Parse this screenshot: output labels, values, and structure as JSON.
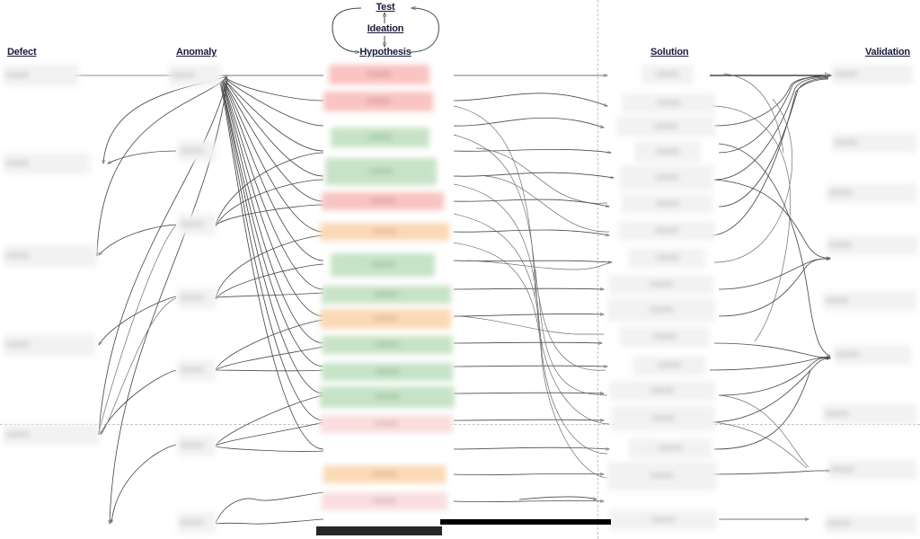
{
  "diagram": {
    "title_columns": [
      "Defect",
      "Anomaly",
      "Hypothesis",
      "Solution",
      "Validation"
    ],
    "columns": {
      "defect": {
        "header": "Defect"
      },
      "anomaly": {
        "header": "Anomaly"
      },
      "hypothesis": {
        "header": "Hypothesis"
      },
      "solution": {
        "header": "Solution"
      },
      "validation": {
        "header": "Validation"
      }
    },
    "cycle": {
      "nodes": [
        "Test",
        "Ideation",
        "Hypothesis"
      ],
      "test_label": "Test",
      "ideation_label": "Ideation",
      "hypothesis_label": "Hypothesis"
    },
    "colors": {
      "node_red": "#f9c3c3",
      "node_pink": "#fadede",
      "node_green": "#c7e3c7",
      "node_orange": "#fbd9b6",
      "node_gray": "#f2f2f2",
      "edge": "#4a4a4a",
      "guide": "#c2c2c2",
      "header_text": "#1a1a3e"
    },
    "defect_nodes": [
      {
        "label": "[redacted]"
      },
      {
        "label": "[redacted]"
      },
      {
        "label": "[redacted]"
      },
      {
        "label": "[redacted]"
      },
      {
        "label": "[redacted]"
      }
    ],
    "anomaly_nodes": [
      {
        "label": "[redacted]"
      },
      {
        "label": "[redacted]"
      },
      {
        "label": "[redacted]"
      },
      {
        "label": "[redacted]"
      },
      {
        "label": "[redacted]"
      },
      {
        "label": "[redacted]"
      },
      {
        "label": "[redacted]"
      }
    ],
    "hypothesis_nodes": [
      {
        "label": "[redacted]",
        "color": "red"
      },
      {
        "label": "[redacted]",
        "color": "red"
      },
      {
        "label": "[redacted]",
        "color": "green"
      },
      {
        "label": "[redacted]",
        "color": "green"
      },
      {
        "label": "[redacted]",
        "color": "red"
      },
      {
        "label": "[redacted]",
        "color": "orange"
      },
      {
        "label": "[redacted]",
        "color": "green"
      },
      {
        "label": "[redacted]",
        "color": "green"
      },
      {
        "label": "[redacted]",
        "color": "orange"
      },
      {
        "label": "[redacted]",
        "color": "green"
      },
      {
        "label": "[redacted]",
        "color": "green"
      },
      {
        "label": "[redacted]",
        "color": "green"
      },
      {
        "label": "[redacted]",
        "color": "pink"
      },
      {
        "label": "[redacted]",
        "color": "orange"
      },
      {
        "label": "[redacted]",
        "color": "pink"
      }
    ],
    "solution_nodes": [
      {
        "label": "[redacted]"
      },
      {
        "label": "[redacted]"
      },
      {
        "label": "[redacted]"
      },
      {
        "label": "[redacted]"
      },
      {
        "label": "[redacted]"
      },
      {
        "label": "[redacted]"
      },
      {
        "label": "[redacted]"
      },
      {
        "label": "[redacted]"
      },
      {
        "label": "[redacted]"
      },
      {
        "label": "[redacted]"
      },
      {
        "label": "[redacted]"
      },
      {
        "label": "[redacted]"
      },
      {
        "label": "[redacted]"
      },
      {
        "label": "[redacted]"
      },
      {
        "label": "[redacted]"
      },
      {
        "label": "[redacted]"
      },
      {
        "label": "[redacted]"
      }
    ],
    "validation_nodes": [
      {
        "label": "[redacted]"
      },
      {
        "label": "[redacted]"
      },
      {
        "label": "[redacted]"
      },
      {
        "label": "[redacted]"
      },
      {
        "label": "[redacted]"
      },
      {
        "label": "[redacted]"
      },
      {
        "label": "[redacted]"
      },
      {
        "label": "[redacted]"
      },
      {
        "label": "[redacted]"
      }
    ]
  }
}
